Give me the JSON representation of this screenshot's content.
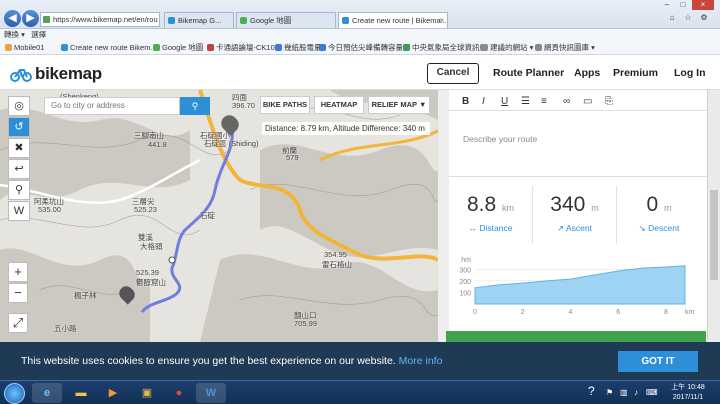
{
  "browser": {
    "url": "https://www.bikemap.net/en/rou",
    "tabs": [
      {
        "label": "Bikemap G...",
        "color": "#2d8fd8",
        "active": false
      },
      {
        "label": "Google 地圖",
        "color": "#4caf50",
        "active": false
      },
      {
        "label": "Create new route | Bikema...",
        "color": "#2d8fd8",
        "active": true
      }
    ],
    "menu": [
      "轉換",
      "選擇"
    ],
    "favorites": [
      "Mobile01",
      "Create new route Bikem...",
      "Google 地圖",
      "卡通語論壇-CK101",
      "幾紙股電量",
      "今日預估尖峰備轉容量率",
      "中央氣象局全球資訊網",
      "建議的網站",
      "網頁快訊圖庫"
    ]
  },
  "header": {
    "logo": "bikemap",
    "cancel": "Cancel",
    "nav": [
      "Route Planner",
      "Apps",
      "Premium",
      "Log In"
    ]
  },
  "map": {
    "search_placeholder": "Go to city or address",
    "buttons": [
      "BIKE PATHS",
      "HEATMAP",
      "RELIEF MAP ▼"
    ],
    "distance_info": "Distance: 8.79 km, Altitude Difference: 340 m",
    "labels": [
      "(Shenkeng)",
      "四面",
      "396.70",
      "三腳南山",
      "441.8",
      "石碇國小",
      "石碇區 (Shiding)",
      "前蘭",
      "579",
      "阿柔坑山",
      "535.00",
      "三層尖",
      "525.23",
      "火燒樟",
      "五分山",
      "657",
      "石碇",
      "外格頭",
      "626.03",
      "烏塗窟",
      "雙溪",
      "大格頭",
      "354.95",
      "雷石格山",
      "525.39",
      "鬱醇窟山",
      "369.62",
      "楓子林",
      "火燒樟",
      "五小路",
      "511",
      "翻山口",
      "705.99",
      "烏塗",
      "(Pin"
    ]
  },
  "panel": {
    "editor_buttons": [
      "B",
      "I",
      "U"
    ],
    "description_placeholder": "Describe your route",
    "stats": [
      {
        "value": "8.8",
        "unit": "km",
        "label": "Distance",
        "icon": "arrows-horizontal-icon"
      },
      {
        "value": "340",
        "unit": "m",
        "label": "Ascent",
        "icon": "arrow-up-right-icon"
      },
      {
        "value": "0",
        "unit": "m",
        "label": "Descent",
        "icon": "arrow-down-right-icon"
      }
    ],
    "chart": {
      "unit_y": "hm",
      "y_ticks": [
        "300",
        "200",
        "100"
      ],
      "x_ticks": [
        "0",
        "2",
        "4",
        "6",
        "8"
      ],
      "unit_x": "km"
    }
  },
  "cookie": {
    "text": "This website uses cookies to ensure you get the best experience on our website.",
    "more": "More info",
    "button": "GOT IT"
  },
  "taskbar": {
    "time": "上午 10:48",
    "date": "2017/11/1"
  },
  "chart_data": {
    "type": "area",
    "x": [
      0,
      1,
      2,
      3,
      4,
      5,
      6,
      7,
      8,
      8.8
    ],
    "y": [
      140,
      165,
      180,
      200,
      215,
      250,
      285,
      310,
      320,
      330
    ],
    "xlabel": "km",
    "ylabel": "hm",
    "xlim": [
      0,
      8.8
    ],
    "ylim": [
      0,
      380
    ]
  }
}
